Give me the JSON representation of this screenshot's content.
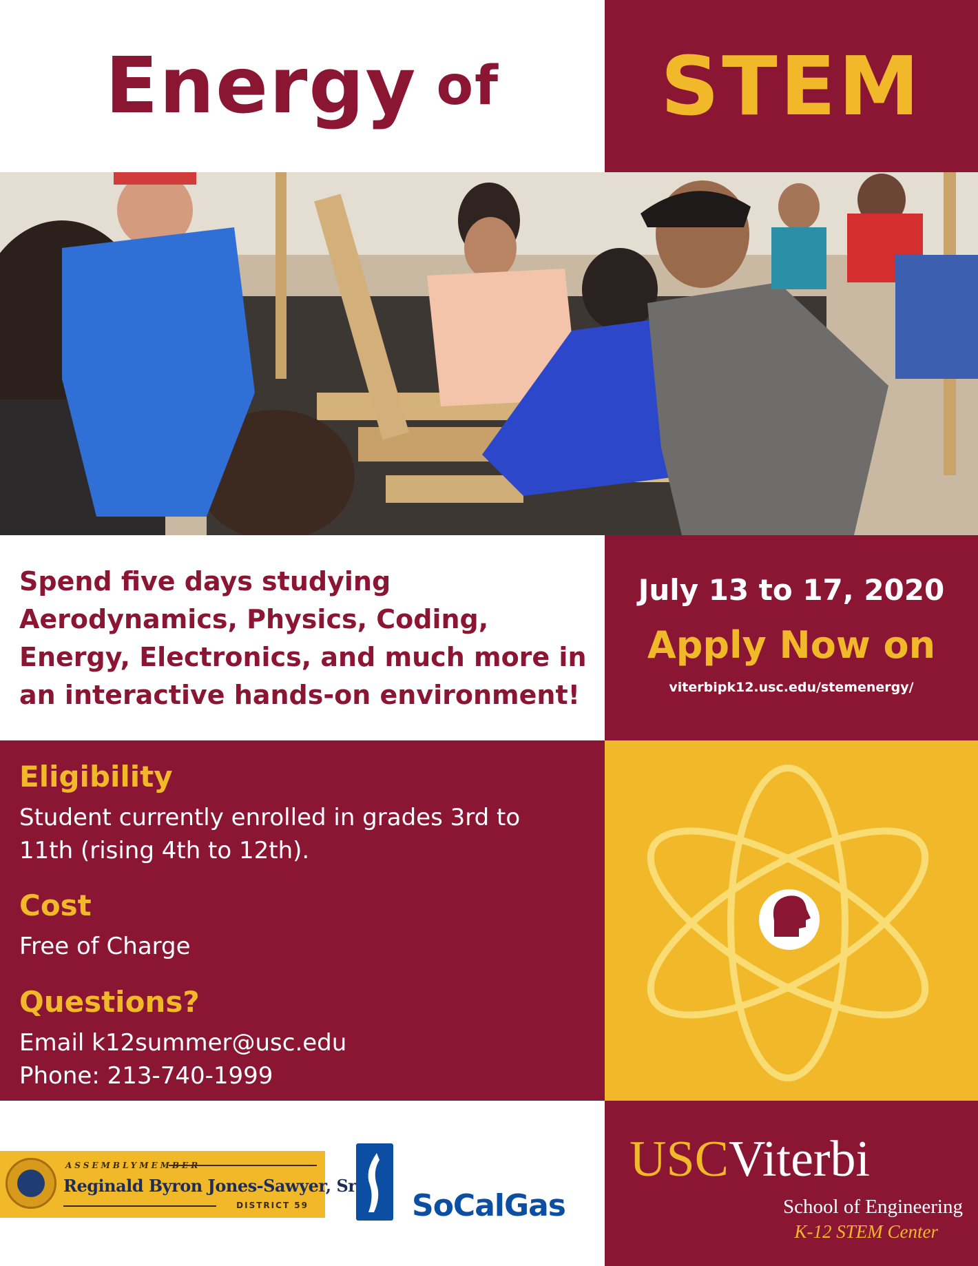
{
  "header": {
    "title_word1": "Energy",
    "title_word2": "of",
    "title_word3": "STEM"
  },
  "photo": {
    "subject": "workshop-photo"
  },
  "description": {
    "line1": "Spend five days studying",
    "line2": "Aerodynamics, Physics, Coding,",
    "line3": "Energy, Electronics, and much more in",
    "line4": "an interactive hands-on environment!"
  },
  "dates": {
    "date_range": "July 13 to 17, 2020",
    "apply_label": "Apply Now on",
    "url": "viterbipk12.usc.edu/stemenergy/"
  },
  "info": {
    "eligibility_heading": "Eligibility",
    "eligibility_line1": "Student currently enrolled in grades 3rd to",
    "eligibility_line2": "11th (rising 4th to 12th).",
    "cost_heading": "Cost",
    "cost_value": "Free of Charge",
    "questions_heading": "Questions?",
    "email_line": "Email k12summer@usc.edu",
    "phone_line": "Phone: 213-740-1999"
  },
  "sponsors": {
    "assembly_title": "ASSEMBLYMEMBER",
    "assembly_name": "Reginald Byron Jones-Sawyer, Sr.",
    "assembly_district": "DISTRICT 59",
    "socal_name": "SoCalGas",
    "usc_part1": "USC",
    "usc_part2": "Viterbi",
    "usc_school": "School of Engineering",
    "usc_center": "K-12 STEM Center"
  },
  "colors": {
    "maroon": "#8b1633",
    "gold": "#f1b929",
    "white": "#ffffff",
    "socal_blue": "#0b4ea2"
  },
  "icons": {
    "atom": "atom-icon",
    "head": "brain-head-icon"
  }
}
